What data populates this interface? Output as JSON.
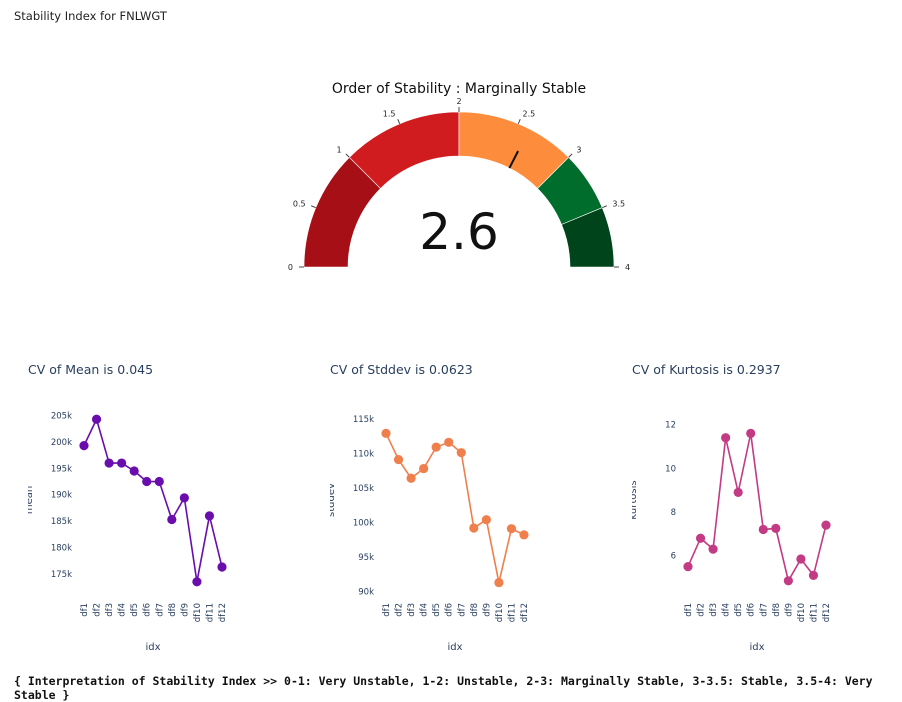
{
  "page": {
    "title": "Stability Index for FNLWGT",
    "footer": "{ Interpretation of Stability Index >> 0-1: Very Unstable, 1-2: Unstable, 2-3: Marginally Stable, 3-3.5: Stable, 3.5-4: Very Stable }"
  },
  "chart_data": [
    {
      "type": "gauge",
      "title": "Order of Stability : Marginally Stable",
      "value": 2.6,
      "value_label": "2.6",
      "range": [
        0,
        4
      ],
      "ticks": [
        0,
        0.5,
        1,
        1.5,
        2,
        2.5,
        3,
        3.5,
        4
      ],
      "tick_labels": [
        "0",
        "0.5",
        "1",
        "1.5",
        "2",
        "2.5",
        "3",
        "3.5",
        "4"
      ],
      "bands": [
        {
          "from": 0,
          "to": 1,
          "color": "#a50f15"
        },
        {
          "from": 1,
          "to": 2,
          "color": "#d01c1f"
        },
        {
          "from": 2,
          "to": 3,
          "color": "#fd8d3c"
        },
        {
          "from": 3,
          "to": 3.5,
          "color": "#006d2c"
        },
        {
          "from": 3.5,
          "to": 4,
          "color": "#00441b"
        }
      ]
    },
    {
      "type": "line",
      "title": "CV of Mean is 0.045",
      "xlabel": "idx",
      "ylabel": "mean",
      "color": "#6a0dad",
      "categories": [
        "df1",
        "df2",
        "df3",
        "df4",
        "df5",
        "df6",
        "df7",
        "df8",
        "df9",
        "df10",
        "df11",
        "df12"
      ],
      "values": [
        199300,
        204300,
        196000,
        196000,
        194500,
        192500,
        192500,
        185300,
        189400,
        173500,
        186000,
        176300
      ],
      "ylim": [
        171000,
        207000
      ],
      "yticks": [
        175000,
        180000,
        185000,
        190000,
        195000,
        200000,
        205000
      ],
      "ytick_labels": [
        "175k",
        "180k",
        "185k",
        "190k",
        "195k",
        "200k",
        "205k"
      ]
    },
    {
      "type": "line",
      "title": "CV of Stddev is 0.0623",
      "xlabel": "idx",
      "ylabel": "stddev",
      "color": "#ef7f4c",
      "categories": [
        "df1",
        "df2",
        "df3",
        "df4",
        "df5",
        "df6",
        "df7",
        "df8",
        "df9",
        "df10",
        "df11",
        "df12"
      ],
      "values": [
        112900,
        109100,
        106400,
        107800,
        110900,
        111600,
        110100,
        99200,
        100400,
        91300,
        99100,
        98200
      ],
      "ylim": [
        89500,
        117000
      ],
      "yticks": [
        90000,
        95000,
        100000,
        105000,
        110000,
        115000
      ],
      "ytick_labels": [
        "90k",
        "95k",
        "100k",
        "105k",
        "110k",
        "115k"
      ]
    },
    {
      "type": "line",
      "title": "CV of Kurtosis is 0.2937",
      "xlabel": "idx",
      "ylabel": "kurtosis",
      "color": "#c23b84",
      "categories": [
        "df1",
        "df2",
        "df3",
        "df4",
        "df5",
        "df6",
        "df7",
        "df8",
        "df9",
        "df10",
        "df11",
        "df12"
      ],
      "values": [
        5.5,
        6.8,
        6.3,
        11.4,
        8.9,
        11.6,
        7.2,
        7.25,
        4.85,
        5.85,
        5.1,
        7.4
      ],
      "ylim": [
        4.2,
        12.9
      ],
      "yticks": [
        6,
        8,
        10,
        12
      ],
      "ytick_labels": [
        "6",
        "8",
        "10",
        "12"
      ]
    }
  ]
}
